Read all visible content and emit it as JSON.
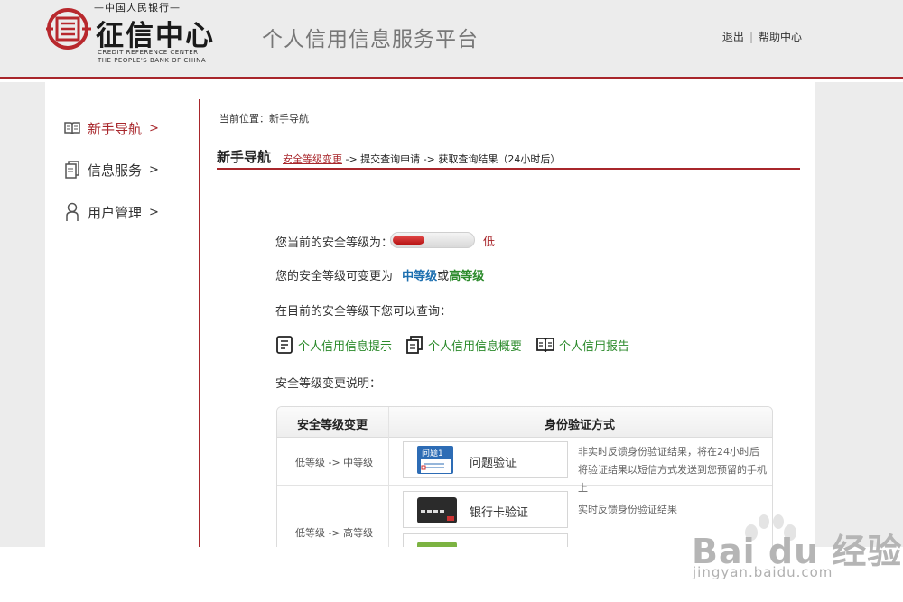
{
  "header": {
    "logo_top": "—中国人民银行—",
    "logo_main": "征信中心",
    "logo_en_line1": "CREDIT REFERENCE CENTER",
    "logo_en_line2": "THE PEOPLE'S BANK OF CHINA",
    "platform_title": "个人信用信息服务平台",
    "logout": "退出",
    "separator": "|",
    "help": "帮助中心",
    "accent_color": "#a8262b"
  },
  "sidebar": {
    "items": [
      {
        "label": "新手导航",
        "arrow": ">",
        "icon": "book-icon",
        "active": true
      },
      {
        "label": "信息服务",
        "arrow": ">",
        "icon": "document-icon",
        "active": false
      },
      {
        "label": "用户管理",
        "arrow": ">",
        "icon": "user-icon",
        "active": false
      }
    ]
  },
  "breadcrumb": "当前位置：新手导航",
  "section": {
    "title": "新手导航",
    "step1": "安全等级变更",
    "step2": "-> 提交查询申请",
    "step3": "-> 获取查询结果（24小时后）"
  },
  "security": {
    "current_label": "您当前的安全等级为：",
    "level_fraction": 0.4,
    "level_text": "低",
    "change_prefix": "您的安全等级可变更为",
    "mid": "中等级",
    "or": "或",
    "high": "高等级",
    "query_label": "在目前的安全等级下您可以查询：",
    "explain_label": "安全等级变更说明："
  },
  "query_links": [
    {
      "label": "个人信用信息提示",
      "icon": "notice-icon"
    },
    {
      "label": "个人信用信息概要",
      "icon": "summary-icon"
    },
    {
      "label": "个人信用报告",
      "icon": "report-book-icon"
    }
  ],
  "table": {
    "headers": [
      "安全等级变更",
      "身份验证方式"
    ],
    "rows": [
      {
        "change": "低等级 -> 中等级",
        "method": "问题验证",
        "method_icon_text": "问题1",
        "desc": "非实时反馈身份验证结果，将在24小时后将验证结果以短信方式发送到您预留的手机上"
      },
      {
        "change": "低等级 -> 高等级",
        "method": "银行卡验证",
        "desc": "实时反馈身份验证结果"
      }
    ]
  },
  "watermark": {
    "brand": "Bai du 经验",
    "url": "jingyan.baidu.com"
  }
}
